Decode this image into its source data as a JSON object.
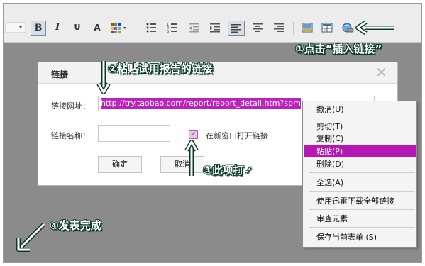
{
  "toolbar": {
    "buttons": [
      "B",
      "I",
      "U",
      "A"
    ],
    "icons": [
      "dropdown-arrow-icon",
      "bold-icon",
      "italic-icon",
      "underline-icon",
      "strikethrough-icon",
      "color-grid-icon",
      "bulleted-list-icon",
      "numbered-list-icon",
      "outdent-icon",
      "indent-icon",
      "align-left-icon",
      "align-center-icon",
      "align-right-icon",
      "insert-image-icon",
      "insert-table-icon",
      "insert-link-icon"
    ]
  },
  "dialog": {
    "title": "链接",
    "url_label": "链接网址：",
    "url_value": "http://try.taobao.com/report/report_detail.htm?spm",
    "name_label": "链接名称：",
    "name_value": "",
    "new_window_label": "在新窗口打开链接",
    "new_window_check": "✓",
    "ok_label": "确定",
    "cancel_label": "取消",
    "close_glyph": "✕"
  },
  "context_menu": {
    "items": [
      "撤消(U)",
      "剪切(T)",
      "复制(C)",
      "粘贴(P)",
      "删除(D)",
      "全选(A)",
      "使用迅雷下载全部链接",
      "审查元素",
      "保存当前表单 (S)"
    ],
    "selected": "粘贴(P)"
  },
  "annotations": {
    "step1": "①点击“插入链接”",
    "step2": "②粘贴试用报告的链接",
    "step3": "③此项打✓",
    "step4": "④发表完成"
  },
  "colors": {
    "selection": "#bf1fbf",
    "annotation_text": "#ffffff",
    "annotation_outline": "#0a3a2a",
    "background_gray": "#8b8b8b"
  }
}
